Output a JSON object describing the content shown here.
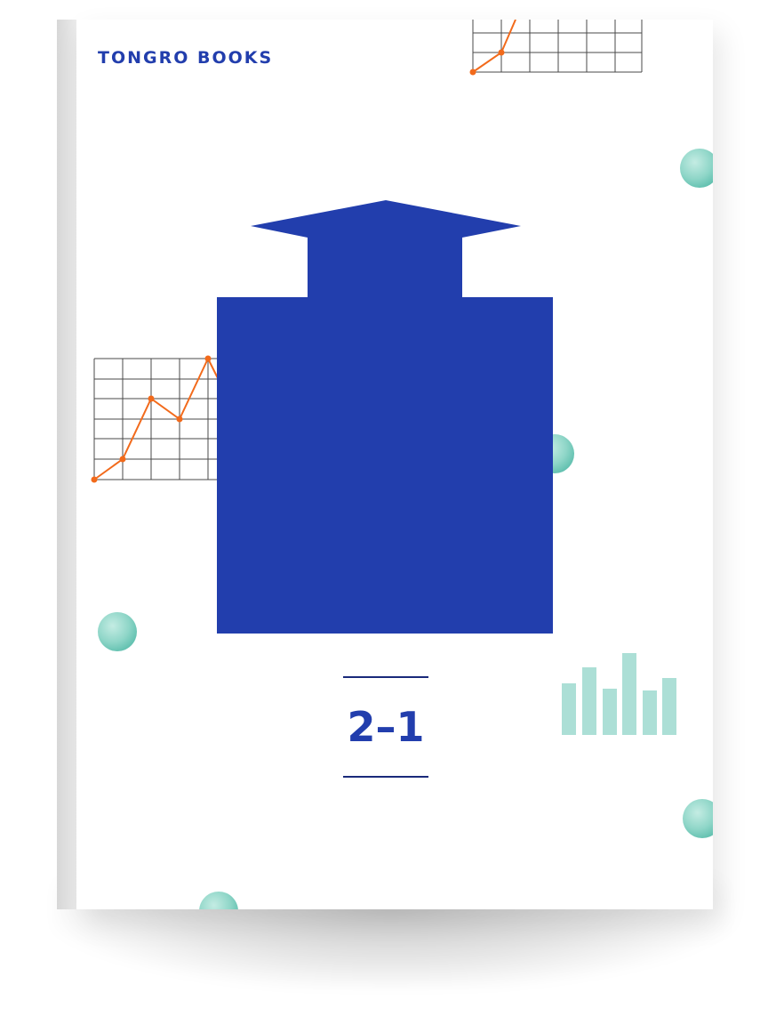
{
  "cover": {
    "publisher": "TONGRO BOOKS",
    "volume": "2–1"
  },
  "colors": {
    "brand_blue": "#223ead",
    "accent_orange": "#f26a1b",
    "mint": "#8fd6c8",
    "mint_light": "#acdfd6",
    "grid_line": "#4a4a4a"
  }
}
